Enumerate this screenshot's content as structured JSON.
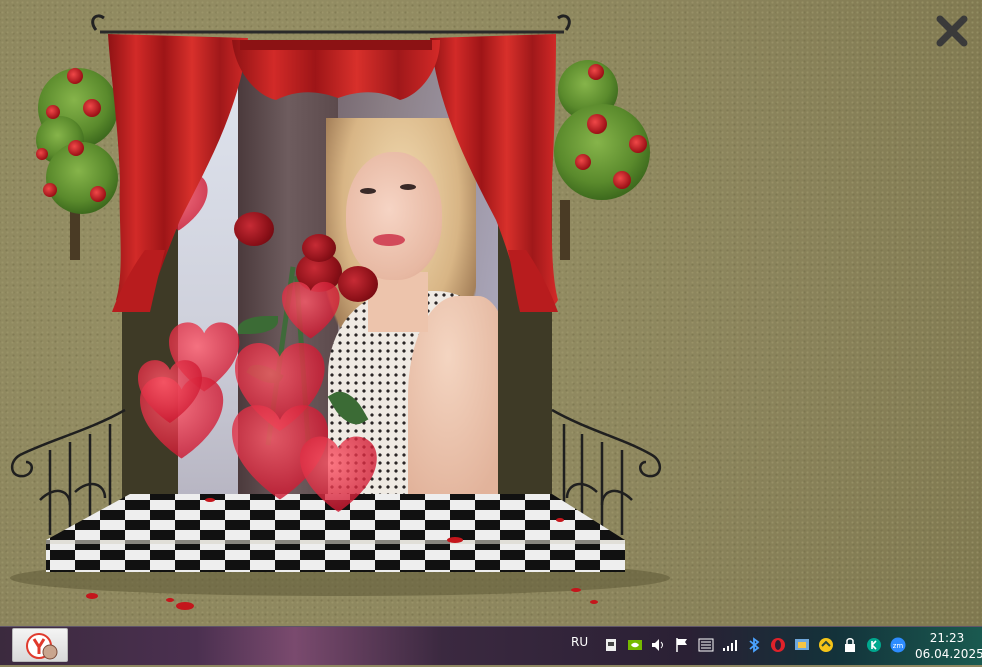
{
  "taskbar": {
    "language": "RU",
    "time": "21:23",
    "date": "06.04.2025",
    "start_app_icon": "yandex-browser-icon",
    "tray_icons": [
      "usb-eject-icon",
      "nvidia-icon",
      "volume-icon",
      "action-center-flag-icon",
      "keyboard-icon",
      "network-signal-icon",
      "bluetooth-icon",
      "opera-icon",
      "app-icon",
      "yandex-disk-icon",
      "lock-icon",
      "kaspersky-icon",
      "zoom-icon"
    ]
  },
  "screen": {
    "close_icon": "close-icon",
    "colors": {
      "curtain": "#c0201f",
      "background": "#8e8760",
      "tree": "#5a8a2c"
    }
  }
}
